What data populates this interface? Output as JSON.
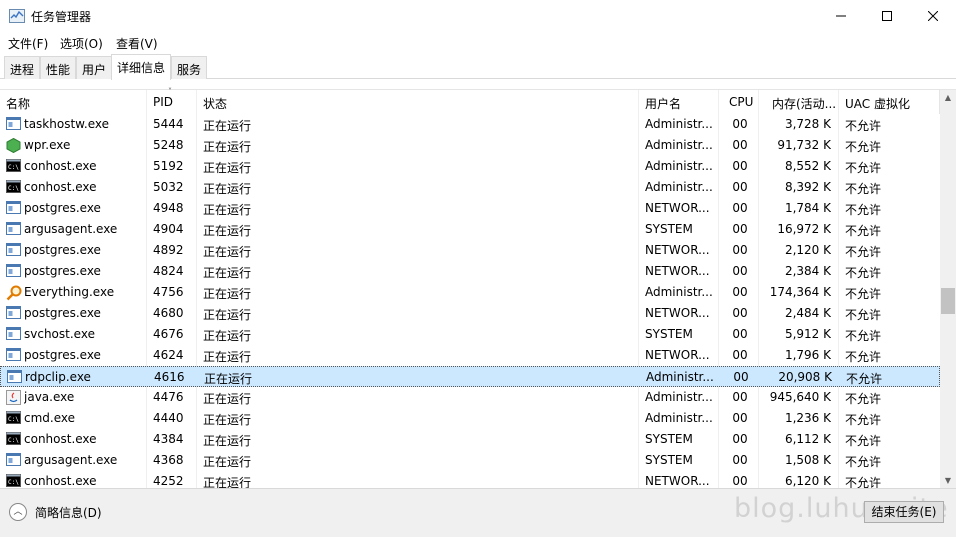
{
  "window": {
    "title": "任务管理器",
    "minimize": "—",
    "maximize": "☐",
    "close": "✕"
  },
  "menu": [
    "文件(F)",
    "选项(O)",
    "查看(V)"
  ],
  "tabs": [
    {
      "label": "进程",
      "active": false
    },
    {
      "label": "性能",
      "active": false
    },
    {
      "label": "用户",
      "active": false
    },
    {
      "label": "详细信息",
      "active": true
    },
    {
      "label": "服务",
      "active": false
    }
  ],
  "columns": {
    "name": "名称",
    "pid": "PID",
    "status": "状态",
    "user": "用户名",
    "cpu": "CPU",
    "mem": "内存(活动...",
    "uac": "UAC 虚拟化"
  },
  "rows": [
    {
      "icon": "window-app-icon",
      "name": "taskhostw.exe",
      "pid": "5444",
      "status": "正在运行",
      "user": "Administr...",
      "cpu": "00",
      "mem": "3,728 K",
      "uac": "不允许",
      "selected": false
    },
    {
      "icon": "green-hexagon-icon",
      "name": "wpr.exe",
      "pid": "5248",
      "status": "正在运行",
      "user": "Administr...",
      "cpu": "00",
      "mem": "91,732 K",
      "uac": "不允许",
      "selected": false
    },
    {
      "icon": "console-icon",
      "name": "conhost.exe",
      "pid": "5192",
      "status": "正在运行",
      "user": "Administr...",
      "cpu": "00",
      "mem": "8,552 K",
      "uac": "不允许",
      "selected": false
    },
    {
      "icon": "console-icon",
      "name": "conhost.exe",
      "pid": "5032",
      "status": "正在运行",
      "user": "Administr...",
      "cpu": "00",
      "mem": "8,392 K",
      "uac": "不允许",
      "selected": false
    },
    {
      "icon": "window-app-icon",
      "name": "postgres.exe",
      "pid": "4948",
      "status": "正在运行",
      "user": "NETWOR...",
      "cpu": "00",
      "mem": "1,784 K",
      "uac": "不允许",
      "selected": false
    },
    {
      "icon": "window-app-icon",
      "name": "argusagent.exe",
      "pid": "4904",
      "status": "正在运行",
      "user": "SYSTEM",
      "cpu": "00",
      "mem": "16,972 K",
      "uac": "不允许",
      "selected": false
    },
    {
      "icon": "window-app-icon",
      "name": "postgres.exe",
      "pid": "4892",
      "status": "正在运行",
      "user": "NETWOR...",
      "cpu": "00",
      "mem": "2,120 K",
      "uac": "不允许",
      "selected": false
    },
    {
      "icon": "window-app-icon",
      "name": "postgres.exe",
      "pid": "4824",
      "status": "正在运行",
      "user": "NETWOR...",
      "cpu": "00",
      "mem": "2,384 K",
      "uac": "不允许",
      "selected": false
    },
    {
      "icon": "magnifier-icon",
      "name": "Everything.exe",
      "pid": "4756",
      "status": "正在运行",
      "user": "Administr...",
      "cpu": "00",
      "mem": "174,364 K",
      "uac": "不允许",
      "selected": false
    },
    {
      "icon": "window-app-icon",
      "name": "postgres.exe",
      "pid": "4680",
      "status": "正在运行",
      "user": "NETWOR...",
      "cpu": "00",
      "mem": "2,484 K",
      "uac": "不允许",
      "selected": false
    },
    {
      "icon": "window-app-icon",
      "name": "svchost.exe",
      "pid": "4676",
      "status": "正在运行",
      "user": "SYSTEM",
      "cpu": "00",
      "mem": "5,912 K",
      "uac": "不允许",
      "selected": false
    },
    {
      "icon": "window-app-icon",
      "name": "postgres.exe",
      "pid": "4624",
      "status": "正在运行",
      "user": "NETWOR...",
      "cpu": "00",
      "mem": "1,796 K",
      "uac": "不允许",
      "selected": false
    },
    {
      "icon": "window-app-icon",
      "name": "rdpclip.exe",
      "pid": "4616",
      "status": "正在运行",
      "user": "Administr...",
      "cpu": "00",
      "mem": "20,908 K",
      "uac": "不允许",
      "selected": true
    },
    {
      "icon": "java-icon",
      "name": "java.exe",
      "pid": "4476",
      "status": "正在运行",
      "user": "Administr...",
      "cpu": "00",
      "mem": "945,640 K",
      "uac": "不允许",
      "selected": false
    },
    {
      "icon": "console-icon",
      "name": "cmd.exe",
      "pid": "4440",
      "status": "正在运行",
      "user": "Administr...",
      "cpu": "00",
      "mem": "1,236 K",
      "uac": "不允许",
      "selected": false
    },
    {
      "icon": "console-icon",
      "name": "conhost.exe",
      "pid": "4384",
      "status": "正在运行",
      "user": "SYSTEM",
      "cpu": "00",
      "mem": "6,112 K",
      "uac": "不允许",
      "selected": false
    },
    {
      "icon": "window-app-icon",
      "name": "argusagent.exe",
      "pid": "4368",
      "status": "正在运行",
      "user": "SYSTEM",
      "cpu": "00",
      "mem": "1,508 K",
      "uac": "不允许",
      "selected": false
    },
    {
      "icon": "console-icon",
      "name": "conhost.exe",
      "pid": "4252",
      "status": "正在运行",
      "user": "NETWOR...",
      "cpu": "00",
      "mem": "6,120 K",
      "uac": "不允许",
      "selected": false
    }
  ],
  "footer": {
    "brief": "简略信息(D)",
    "end_task": "结束任务(E)",
    "watermark": "blog.luhua.site"
  },
  "colors": {
    "selected_row": "#cce8ff",
    "footer_bg": "#f0f0f0"
  }
}
